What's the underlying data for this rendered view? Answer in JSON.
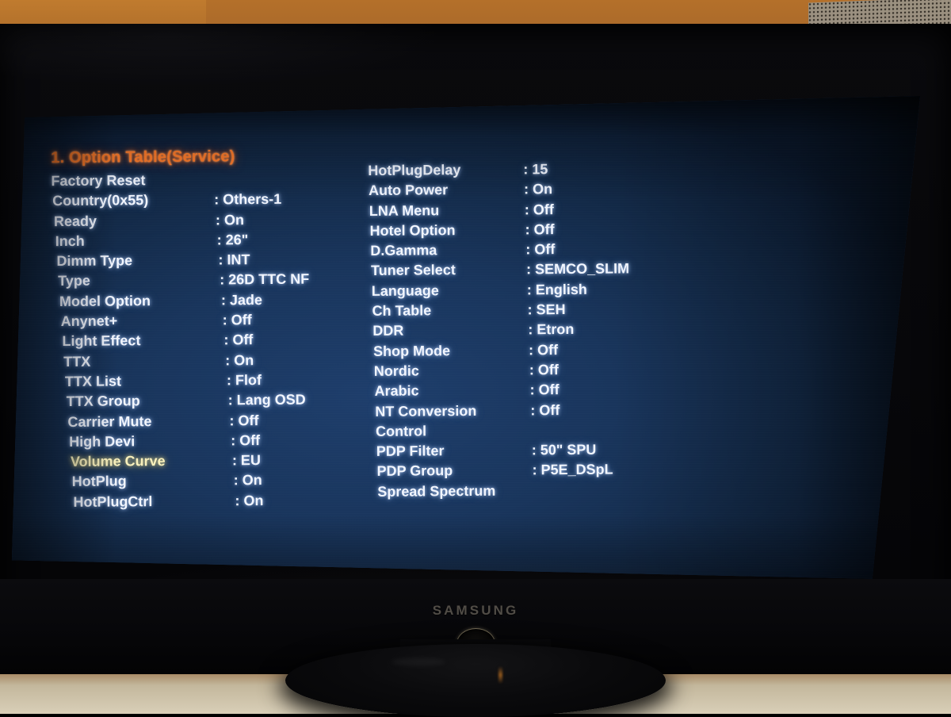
{
  "device": {
    "brand_logo": "SAMSUNG",
    "power_indicator": "power-ring",
    "screen_background_color": "#17345a",
    "accent_title_color": "#ff7b2a",
    "text_color": "#f2f6ff",
    "selected_row_color": "#f8f0bc"
  },
  "osd": {
    "title": "1. Option Table(Service)",
    "columns": [
      {
        "id": "left",
        "rows": [
          {
            "label": "Factory Reset",
            "value": "",
            "selected": false,
            "has_value": false
          },
          {
            "label": "Country(0x55)",
            "value": "Others-1",
            "selected": false,
            "has_value": true
          },
          {
            "label": "Ready",
            "value": "On",
            "selected": false,
            "has_value": true
          },
          {
            "label": "Inch",
            "value": "26\"",
            "selected": false,
            "has_value": true
          },
          {
            "label": "Dimm Type",
            "value": "INT",
            "selected": false,
            "has_value": true
          },
          {
            "label": "Type",
            "value": "26D TTC NF",
            "selected": false,
            "has_value": true
          },
          {
            "label": "Model Option",
            "value": "Jade",
            "selected": false,
            "has_value": true
          },
          {
            "label": "Anynet+",
            "value": "Off",
            "selected": false,
            "has_value": true
          },
          {
            "label": "Light Effect",
            "value": "Off",
            "selected": false,
            "has_value": true
          },
          {
            "label": "TTX",
            "value": "On",
            "selected": false,
            "has_value": true
          },
          {
            "label": "TTX List",
            "value": "Flof",
            "selected": false,
            "has_value": true
          },
          {
            "label": "TTX Group",
            "value": "Lang OSD",
            "selected": false,
            "has_value": true
          },
          {
            "label": "Carrier Mute",
            "value": "Off",
            "selected": false,
            "has_value": true
          },
          {
            "label": "High Devi",
            "value": "Off",
            "selected": false,
            "has_value": true
          },
          {
            "label": "Volume Curve",
            "value": "EU",
            "selected": true,
            "has_value": true
          },
          {
            "label": "HotPlug",
            "value": "On",
            "selected": false,
            "has_value": true
          },
          {
            "label": "HotPlugCtrl",
            "value": "On",
            "selected": false,
            "has_value": true
          }
        ]
      },
      {
        "id": "right",
        "rows": [
          {
            "label": "HotPlugDelay",
            "value": "15",
            "selected": false,
            "has_value": true
          },
          {
            "label": "Auto Power",
            "value": "On",
            "selected": false,
            "has_value": true
          },
          {
            "label": "LNA Menu",
            "value": "Off",
            "selected": false,
            "has_value": true
          },
          {
            "label": "Hotel Option",
            "value": "Off",
            "selected": false,
            "has_value": true
          },
          {
            "label": "D.Gamma",
            "value": "Off",
            "selected": false,
            "has_value": true
          },
          {
            "label": "Tuner Select",
            "value": "SEMCO_SLIM",
            "selected": false,
            "has_value": true
          },
          {
            "label": "Language",
            "value": "English",
            "selected": false,
            "has_value": true
          },
          {
            "label": "Ch Table",
            "value": "SEH",
            "selected": false,
            "has_value": true
          },
          {
            "label": "DDR",
            "value": "Etron",
            "selected": false,
            "has_value": true
          },
          {
            "label": "Shop Mode",
            "value": "Off",
            "selected": false,
            "has_value": true
          },
          {
            "label": "Nordic",
            "value": "Off",
            "selected": false,
            "has_value": true
          },
          {
            "label": "Arabic",
            "value": "Off",
            "selected": false,
            "has_value": true
          },
          {
            "label": "NT Conversion",
            "value": "Off",
            "selected": false,
            "has_value": true
          },
          {
            "label": "Control",
            "value": "",
            "selected": false,
            "has_value": false
          },
          {
            "label": "PDP Filter",
            "value": "50\" SPU",
            "selected": false,
            "has_value": true
          },
          {
            "label": "PDP Group",
            "value": "P5E_DSpL",
            "selected": false,
            "has_value": true
          },
          {
            "label": "Spread Spectrum",
            "value": "",
            "selected": false,
            "has_value": false
          }
        ]
      }
    ]
  }
}
